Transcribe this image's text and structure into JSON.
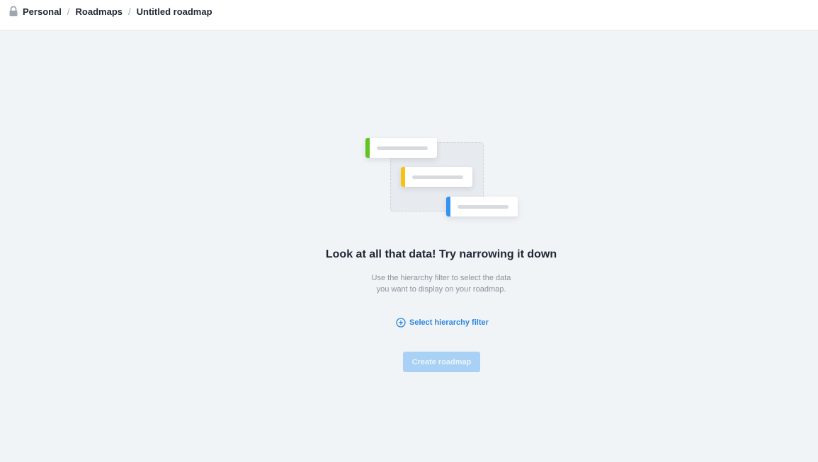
{
  "breadcrumb": {
    "lock_icon": "lock-icon",
    "items": [
      "Personal",
      "Roadmaps",
      "Untitled roadmap"
    ],
    "separator": "/"
  },
  "empty_state": {
    "title": "Look at all that data! Try narrowing it down",
    "subtitle_line1": "Use the hierarchy filter to select the data",
    "subtitle_line2": "you want to display on your roadmap.",
    "filter_link_label": "Select hierarchy filter",
    "filter_link_icon": "plus-circle-icon",
    "create_button_label": "Create roadmap"
  },
  "colors": {
    "background": "#f1f4f7",
    "accent": "#2b86dd",
    "button_disabled": "#a9d0f5",
    "card_green": "#62c321",
    "card_yellow": "#f8c211",
    "card_blue": "#3394f0"
  }
}
